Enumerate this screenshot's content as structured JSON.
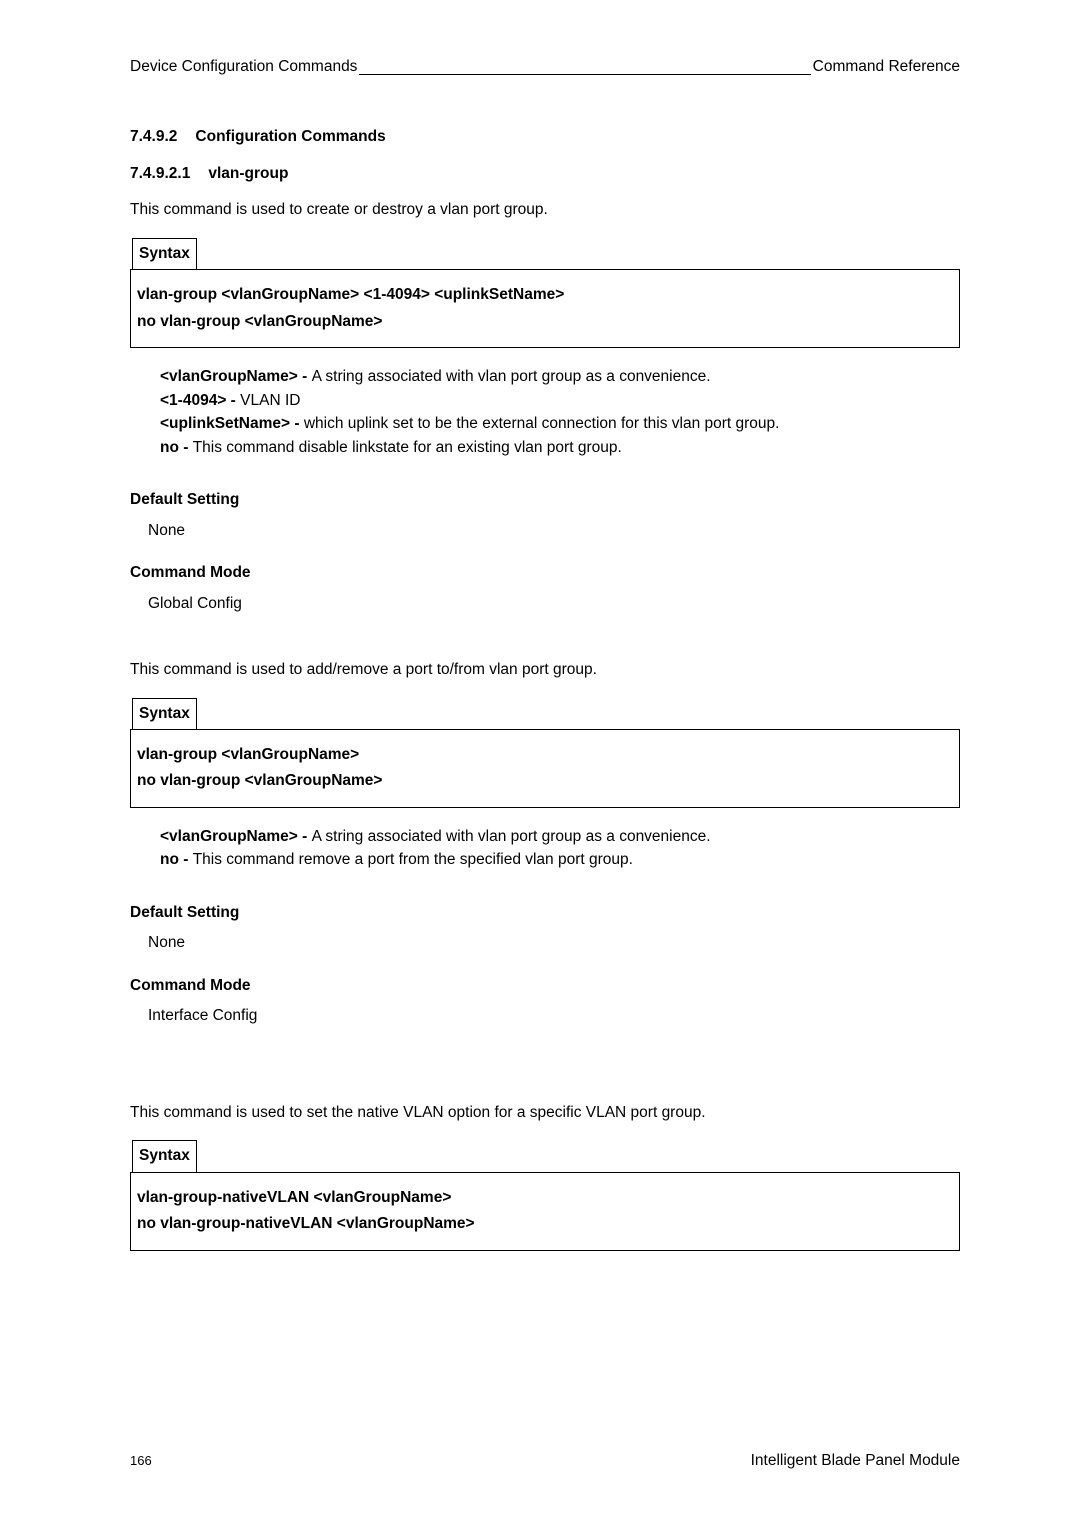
{
  "header": {
    "left": "Device Configuration Commands",
    "right": "Command Reference"
  },
  "sec1": {
    "num": "7.4.9.2",
    "title": "Configuration Commands"
  },
  "sec2": {
    "num": "7.4.9.2.1",
    "title": "vlan-group"
  },
  "block1": {
    "intro": "This command is used to create or destroy a vlan port group.",
    "syntax_label": "Syntax",
    "line1": "vlan-group <vlanGroupName> <1-4094> <uplinkSetName>",
    "line2": "no vlan-group <vlanGroupName>",
    "d1a": "<vlanGroupName> - ",
    "d1b": "A string associated with vlan port group as a convenience.",
    "d2a": "<1-4094> - ",
    "d2b": "VLAN ID",
    "d3a": "<uplinkSetName> - ",
    "d3b": "which uplink set to be the external connection for this vlan port group.",
    "d4a": "no - ",
    "d4b": "This command disable linkstate for an existing vlan port group.",
    "default_h": "Default Setting",
    "default_v": "None",
    "mode_h": "Command Mode",
    "mode_v": "Global Config"
  },
  "block2": {
    "intro": "This command is used to add/remove a port to/from vlan port group.",
    "syntax_label": "Syntax",
    "line1": "vlan-group <vlanGroupName>",
    "line2": "no vlan-group <vlanGroupName>",
    "d1a": "<vlanGroupName> - ",
    "d1b": "A string associated with vlan port group as a convenience.",
    "d2a": "no - ",
    "d2b": "This command remove a port from the specified vlan port group.",
    "default_h": "Default Setting",
    "default_v": "None",
    "mode_h": "Command Mode",
    "mode_v": "Interface Config"
  },
  "block3": {
    "intro": "This command is used to set the native VLAN option for a specific VLAN port group.",
    "syntax_label": "Syntax",
    "line1": "vlan-group-nativeVLAN <vlanGroupName>",
    "line2": "no vlan-group-nativeVLAN <vlanGroupName>"
  },
  "footer": {
    "page": "166",
    "doc": "Intelligent Blade Panel Module"
  }
}
